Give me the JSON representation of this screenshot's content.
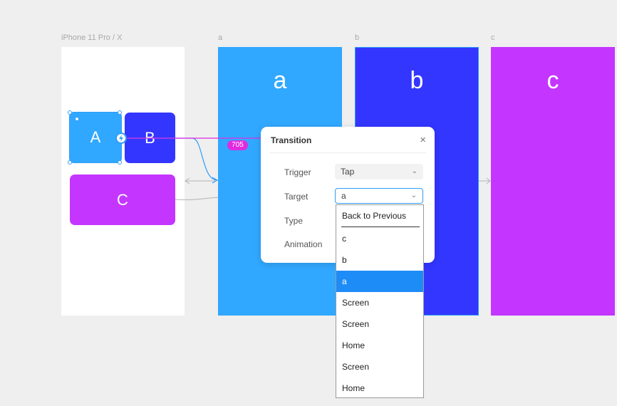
{
  "frames": {
    "device": {
      "label": "iPhone 11 Pro / X"
    },
    "a": {
      "label": "a",
      "big_letter": "a",
      "color": "#31a8ff"
    },
    "b": {
      "label": "b",
      "big_letter": "b",
      "color": "#3336ff"
    },
    "c": {
      "label": "c",
      "big_letter": "c",
      "color": "#c436ff"
    }
  },
  "layers": {
    "A": {
      "text": "A",
      "color": "#31a8ff"
    },
    "B": {
      "text": "B",
      "color": "#3336ff"
    },
    "C": {
      "text": "C",
      "color": "#c436ff"
    }
  },
  "connector_badge": "705",
  "transition_panel": {
    "title": "Transition",
    "close_icon": "×",
    "trigger_label": "Trigger",
    "trigger_value": "Tap",
    "target_label": "Target",
    "target_value": "a",
    "type_label": "Type",
    "animation_label": "Animation"
  },
  "target_dropdown": {
    "items": [
      "Back to Previous",
      "c",
      "b",
      "a",
      "Screen",
      "Screen",
      "Home",
      "Screen",
      "Home"
    ],
    "selected": "a"
  },
  "colors": {
    "accent": "#1e8cf7",
    "link": "#e02be0",
    "canvas": "#efefef"
  }
}
